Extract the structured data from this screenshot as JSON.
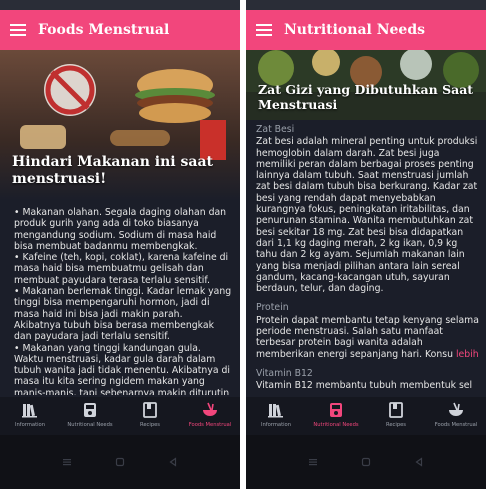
{
  "colors": {
    "accent": "#f2467c",
    "appbar": "#f2467c",
    "background": "#1b1e29",
    "text": "#e6e6e6",
    "muted": "#9aa0aa"
  },
  "left_screen": {
    "title": "Foods Menstrual",
    "hero_title": "Hindari Makanan ini saat menstruasi!",
    "bullets": [
      "• Makanan olahan. Segala daging olahan dan produk gurih yang ada di toko biasanya mengandung sodium. Sodium di masa haid bisa membuat badanmu membengkak.",
      "• Kafeine (teh, kopi, coklat), karena kafeine di masa haid bisa membuatmu gelisah dan membuat payudara terasa terlalu sensitif.",
      "• Makanan berlemak tinggi. Kadar lemak yang tinggi bisa mempengaruhi hormon, jadi di masa haid ini bisa jadi makin parah. Akibatnya tubuh bisa berasa membengkak dan payudara jadi terlalu sensitif.",
      "• Makanan yang tinggi kandungan gula. Waktu menstruasi, kadar gula darah dalam tubuh wanita jadi tidak menentu. Akibatnya di masa itu kita sering ngidem makan yang manis-manis, tapi sebenarnya makin diturutin malah"
    ]
  },
  "right_screen": {
    "title": "Nutritional Needs",
    "hero_title": "Zat Gizi yang Dibutuhkan Saat Menstruasi",
    "sections": [
      {
        "heading": "Zat Besi",
        "body": "Zat besi adalah mineral penting untuk produksi hemoglobin dalam darah. Zat besi juga memiliki peran dalam berbagai proses penting lainnya dalam tubuh. Saat menstruasi jumlah zat besi dalam tubuh bisa berkurang. Kadar zat besi yang rendah dapat menyebabkan kurangnya fokus, peningkatan iritabilitas, dan penurunan stamina. Wanita membutuhkan zat besi sekitar 18 mg. Zat besi bisa didapatkan dari 1,1 kg daging merah, 2 kg ikan, 0,9 kg tahu dan 2 kg ayam. Sejumlah makanan lain yang bisa menjadi pilihan antara lain sereal gandum, kacang-kacangan utuh, sayuran berdaun, telur, dan daging."
      },
      {
        "heading": "Protein",
        "body": "Protein dapat membantu tetap kenyang selama periode menstruasi. Salah satu manfaat terbesar protein bagi wanita adalah memberikan energi sepanjang hari. Konsu",
        "more": "lebih"
      },
      {
        "heading": "Vitamin B12",
        "body": "Vitamin B12 membantu tubuh membentuk sel"
      }
    ]
  },
  "nav": {
    "items": [
      {
        "label": "Information",
        "icon": "books-icon"
      },
      {
        "label": "Nutritional Needs",
        "icon": "scale-icon"
      },
      {
        "label": "Recipes",
        "icon": "recipe-book-icon"
      },
      {
        "label": "Foods Menstrual",
        "icon": "food-bowl-icon"
      }
    ],
    "left_active": 3,
    "right_active": 1
  },
  "system": {
    "buttons": [
      "menu-button-icon",
      "home-button-icon",
      "back-button-icon"
    ]
  }
}
